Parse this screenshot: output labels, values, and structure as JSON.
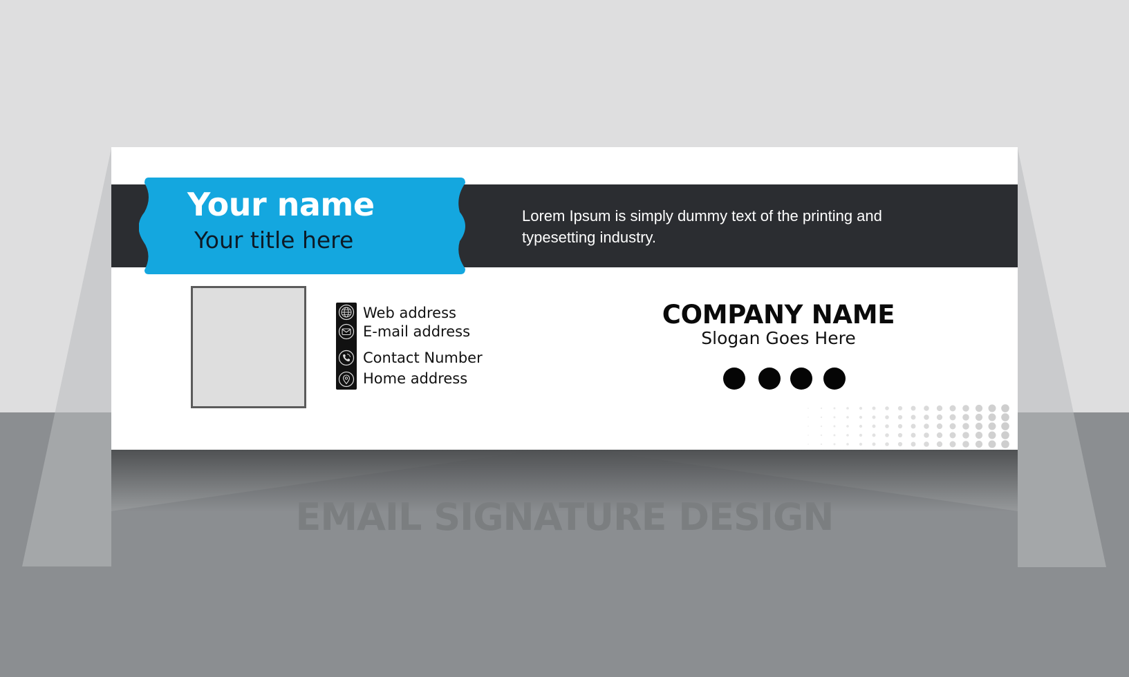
{
  "signature": {
    "name": "Your name",
    "title": "Your title here",
    "tagline": "Lorem Ipsum is simply dummy text of the printing and typesetting industry.",
    "photo_placeholder": "photo-placeholder",
    "contacts": [
      {
        "icon": "globe-icon",
        "label": "Web address"
      },
      {
        "icon": "envelope-icon",
        "label": "E-mail address"
      },
      {
        "icon": "phone-icon",
        "label": "Contact Number"
      },
      {
        "icon": "location-pin-icon",
        "label": "Home address"
      }
    ],
    "company": {
      "name": "COMPANY NAME",
      "slogan": "Slogan Goes Here"
    },
    "social_icons": [
      "social-icon-1",
      "social-icon-2",
      "social-icon-3",
      "social-icon-4"
    ]
  },
  "caption": "EMAIL SIGNATURE DESIGN",
  "colors": {
    "accent_blue": "#14a7df",
    "band_dark": "#2b2d31",
    "background_light": "#dededf",
    "floor_gray": "#8b8e91",
    "text_dark": "#0a0a0a"
  }
}
